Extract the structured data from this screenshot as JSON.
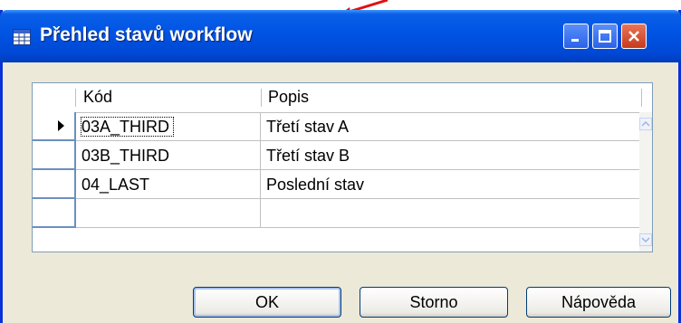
{
  "window": {
    "title": "Přehled stavů workflow",
    "accent_color": "#0055e5"
  },
  "grid": {
    "columns": [
      "Kód",
      "Popis"
    ],
    "rows": [
      {
        "code": "03A_THIRD",
        "description": "Třetí stav A",
        "selected": true
      },
      {
        "code": "03B_THIRD",
        "description": "Třetí stav B",
        "selected": false
      },
      {
        "code": "04_LAST",
        "description": "Poslední stav",
        "selected": false
      },
      {
        "code": "",
        "description": "",
        "selected": false
      }
    ]
  },
  "buttons": {
    "ok": "OK",
    "cancel": "Storno",
    "help": "Nápověda"
  },
  "icons": {
    "title": "table-icon",
    "minimize": "minimize-icon",
    "maximize": "maximize-icon",
    "close": "close-icon",
    "row_pointer": "row-pointer-icon",
    "scroll_up": "scroll-up-icon",
    "scroll_down": "scroll-down-icon",
    "annotation": "red-arrow-icon"
  }
}
